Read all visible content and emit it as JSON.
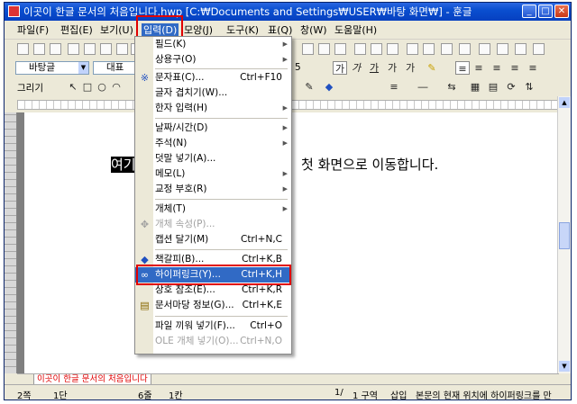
{
  "window": {
    "title": "이곳이 한글 문서의 처음입니다.hwp [C:₩Documents and Settings₩USER₩바탕 화면₩] - 훈글"
  },
  "menubar": {
    "items": [
      {
        "label": "파일(F)"
      },
      {
        "label": "편집(E)"
      },
      {
        "label": "보기(U)"
      },
      {
        "label": "입력(D)"
      },
      {
        "label": "모양(J)"
      },
      {
        "label": "도구(K)"
      },
      {
        "label": "표(Q)"
      },
      {
        "label": "창(W)"
      },
      {
        "label": "도움말(H)"
      }
    ]
  },
  "toolbar": {
    "style_value": "바탕글",
    "font_value": "대표",
    "font_size": "5",
    "draw_label": "그리기"
  },
  "input_menu": {
    "items": [
      {
        "label": "필드(K)",
        "shortcut": "",
        "submenu": true
      },
      {
        "label": "상용구(O)",
        "shortcut": "",
        "submenu": true
      },
      {
        "label": "문자표(C)...",
        "shortcut": "Ctrl+F10",
        "submenu": false
      },
      {
        "label": "글자 겹치기(W)...",
        "shortcut": "",
        "submenu": false
      },
      {
        "label": "한자 입력(H)",
        "shortcut": "",
        "submenu": true
      },
      {
        "label": "날짜/시간(D)",
        "shortcut": "",
        "submenu": true
      },
      {
        "label": "주석(N)",
        "shortcut": "",
        "submenu": true
      },
      {
        "label": "덧말 넣기(A)...",
        "shortcut": "",
        "submenu": false
      },
      {
        "label": "메모(L)",
        "shortcut": "",
        "submenu": true
      },
      {
        "label": "교정 부호(R)",
        "shortcut": "",
        "submenu": true
      },
      {
        "label": "개체(T)",
        "shortcut": "",
        "submenu": true
      },
      {
        "label": "개체 속성(P)...",
        "shortcut": "",
        "submenu": false,
        "disabled": true
      },
      {
        "label": "캡션 달기(M)",
        "shortcut": "Ctrl+N,C",
        "submenu": false
      },
      {
        "label": "책갈피(B)...",
        "shortcut": "Ctrl+K,B",
        "submenu": false
      },
      {
        "label": "하이퍼링크(Y)...",
        "shortcut": "Ctrl+K,H",
        "submenu": false,
        "highlighted": true
      },
      {
        "label": "상호 참조(E)...",
        "shortcut": "Ctrl+K,R",
        "submenu": false
      },
      {
        "label": "문서마당 정보(G)...",
        "shortcut": "Ctrl+K,E",
        "submenu": false
      },
      {
        "label": "파일 끼워 넣기(F)...",
        "shortcut": "Ctrl+O",
        "submenu": false
      },
      {
        "label": "OLE 개체 넣기(O)...",
        "shortcut": "Ctrl+N,O",
        "submenu": false,
        "disabled": true
      }
    ]
  },
  "document": {
    "selected_text": "여기",
    "body_text": "첫 화면으로 이동합니다."
  },
  "tab": {
    "label": "이곳이 한글 문서의 처음입니다"
  },
  "statusbar": {
    "page": "2쪽",
    "section": "1단",
    "line": "6줄",
    "column": "1칸",
    "position": "1/",
    "division": "1 구역",
    "mode": "삽입",
    "message": "본문의 현재 위치에 하이퍼링크를 만"
  },
  "colors": {
    "accent": "#316ac5",
    "annotation": "#e00000"
  }
}
